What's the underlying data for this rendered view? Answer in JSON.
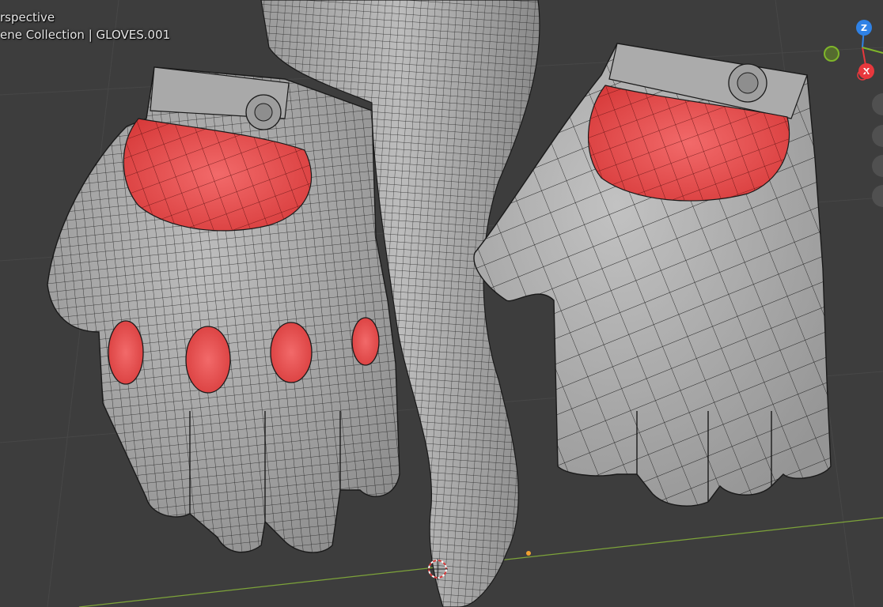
{
  "viewport": {
    "view_label": "rspective",
    "collection_label": "ene Collection | GLOVES.001"
  },
  "gizmo": {
    "axes": [
      {
        "label": "Z",
        "color": "#2f82e6"
      },
      {
        "label": "X",
        "color": "#e8383d"
      },
      {
        "label": "",
        "color": "#7fb62a"
      },
      {
        "label": "",
        "color": "#e8383d"
      }
    ]
  },
  "colors": {
    "background": "#3d3d3d",
    "grid": "#474747",
    "mesh": "#b5b5b5",
    "wire": "#1a1a1a",
    "selected_face": "#ee4444",
    "x_axis_line": "#7da33a",
    "y_axis_line": "#a33a3a"
  },
  "icons": [
    "3d-cursor-icon",
    "navigation-gizmo-icon",
    "zoom-icon",
    "hand-pan-icon",
    "camera-icon",
    "grid-view-icon"
  ]
}
